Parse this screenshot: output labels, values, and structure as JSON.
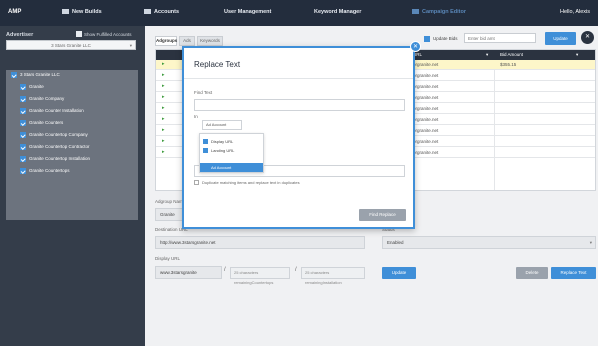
{
  "topbar": {
    "brand": "AMP",
    "nav": [
      "New Builds",
      "Accounts",
      "User Management",
      "Keyword Manager",
      "Campaign Editor"
    ],
    "user": "Hello, Alexis"
  },
  "sidebar": {
    "heading": "Advertiser",
    "toggle_label": "Show Fulfilled Accounts",
    "selected_account": "3 Stars Granite LLC",
    "tree": [
      "3 Stars Granite LLC",
      "Granite",
      "Granite Company",
      "Granite Counter Installation",
      "Granite Counters",
      "Granite Countertop Company",
      "Granite Countertop Contractor",
      "Granite Countertop Installation",
      "Granite Countertops"
    ]
  },
  "toolbar": {
    "tabs": [
      "Adgroups",
      "Ads",
      "Keywords"
    ],
    "update_label": "Update Bids",
    "bid_placeholder": "Enter bid amt",
    "update_button": "Update",
    "close_glyph": "✕"
  },
  "grid": {
    "url_header": "URL",
    "bid_header": "Bid Amount",
    "rows": [
      {
        "url": "orgranite.net",
        "bid": "$355.15"
      },
      {
        "url": "orgranite.net",
        "bid": ""
      },
      {
        "url": "orgranite.net",
        "bid": ""
      },
      {
        "url": "orgranite.net",
        "bid": ""
      },
      {
        "url": "orgranite.net",
        "bid": ""
      },
      {
        "url": "orgranite.net",
        "bid": ""
      },
      {
        "url": "orgranite.net",
        "bid": ""
      },
      {
        "url": "orgranite.net",
        "bid": ""
      },
      {
        "url": "orgranite.net",
        "bid": ""
      }
    ]
  },
  "form": {
    "adgroup_label": "Adgroup Name",
    "adgroup_value": "Granite",
    "dest_label": "Destination URL",
    "dest_value": "http://www.3starsgranite.net",
    "status_label": "Status",
    "status_value": "Enabled",
    "display_label": "Display URL",
    "display_value": "www.3starsgranite",
    "path_hint": "25 characters remaining",
    "path1": "Countertops",
    "path2": "Installation",
    "update_btn": "Update",
    "delete_btn": "Delete",
    "replace_btn": "Replace Text"
  },
  "modal": {
    "title": "Replace Text",
    "find_label": "Find Text",
    "in_label": "In",
    "in_dropdown": "Ad Account",
    "options": [
      "Display URL",
      "Landing URL",
      "Ad Account"
    ],
    "checkbox_label": "Duplicate matching items and replace text in duplicates",
    "button": "Find Replace",
    "close_glyph": "✕"
  }
}
